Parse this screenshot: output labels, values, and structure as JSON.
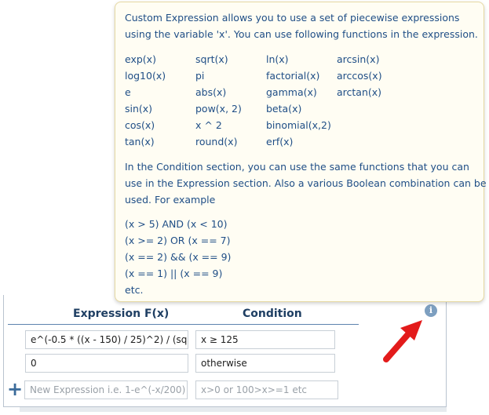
{
  "tooltip": {
    "intro_line1": "Custom Expression allows you to use a set of piecewise expressions",
    "intro_line2": "using the variable 'x'. You can use following functions in the expression.",
    "functions": {
      "col1": [
        "exp(x)",
        "log10(x)",
        "e",
        "sin(x)",
        "cos(x)",
        "tan(x)"
      ],
      "col2": [
        "sqrt(x)",
        "pi",
        "abs(x)",
        "pow(x, 2)",
        "x ^ 2",
        "round(x)"
      ],
      "col3": [
        "ln(x)",
        "factorial(x)",
        "gamma(x)",
        "beta(x)",
        "binomial(x,2)",
        "erf(x)"
      ],
      "col4": [
        "arcsin(x)",
        "arccos(x)",
        "arctan(x)"
      ]
    },
    "condition_line1": "In the Condition section, you can use the same functions that you can",
    "condition_line2": "use in the Expression section. Also a various Boolean combination can be",
    "condition_line3": "used. For example",
    "examples": [
      "(x > 5) AND (x < 10)",
      "(x >= 2) OR (x == 7)",
      "(x == 2) && (x == 9)",
      "(x == 1) || (x == 9)",
      "etc."
    ]
  },
  "table": {
    "expression_header": "Expression F(x)",
    "condition_header": "Condition",
    "rows": [
      {
        "expression": "e^(-0.5 * ((x - 150) / 25)^2) / (sqrt(",
        "condition": "x ≥ 125"
      },
      {
        "expression": "0",
        "condition": "otherwise"
      }
    ],
    "new_expression_placeholder": "New Expression i.e. 1-e^(-x/200)",
    "new_condition_placeholder": "x>0 or 100>x>=1 etc"
  },
  "icons": {
    "add": "plus-icon",
    "info": "info-icon",
    "pointer": "red-arrow-annotation"
  },
  "colors": {
    "tooltip_text": "#1f4e86",
    "header_text": "#1f3f63",
    "arrow": "#e31b1b",
    "info": "#7d9fc0"
  }
}
